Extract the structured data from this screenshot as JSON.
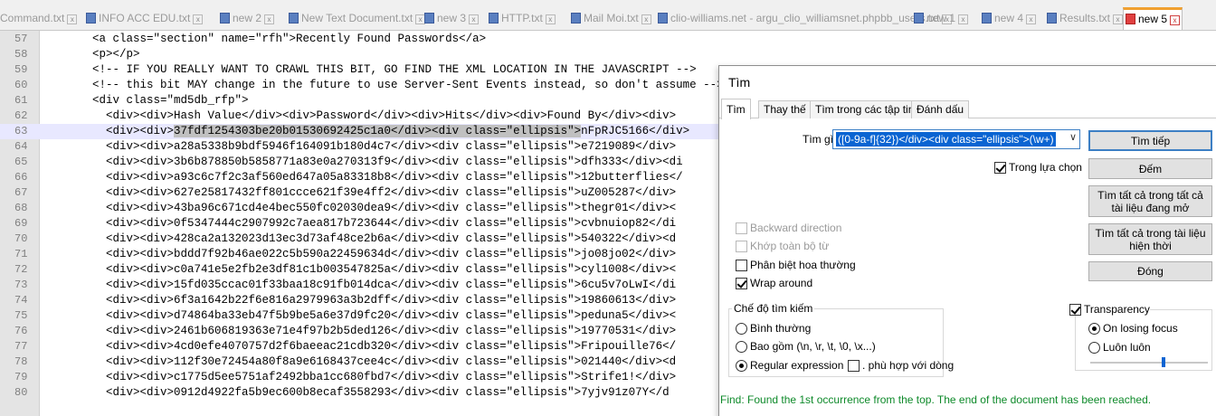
{
  "tabs": [
    {
      "label": "Command.txt",
      "active": false
    },
    {
      "label": "INFO ACC EDU.txt",
      "active": false
    },
    {
      "label": "new 2",
      "active": false
    },
    {
      "label": "New Text Document.txt",
      "active": false
    },
    {
      "label": "new 3",
      "active": false
    },
    {
      "label": "HTTP.txt",
      "active": false
    },
    {
      "label": "Mail Moi.txt",
      "active": false
    },
    {
      "label": "clio-williams.net - argu_clio_williamsnet.phpbb_users.txt",
      "active": false
    },
    {
      "label": "new 1",
      "active": false
    },
    {
      "label": "new 4",
      "active": false
    },
    {
      "label": "Results.txt",
      "active": false
    },
    {
      "label": "new 5",
      "active": true
    }
  ],
  "tab_close_glyph": "x",
  "editor": {
    "lines": [
      {
        "num": "57",
        "text": "<a class=\"section\" name=\"rfh\">Recently Found Passwords</a>"
      },
      {
        "num": "58",
        "text": "<p></p>"
      },
      {
        "num": "59",
        "text": "<!-- IF YOU REALLY WANT TO CRAWL THIS BIT, GO FIND THE XML LOCATION IN THE JAVASCRIPT -->"
      },
      {
        "num": "60",
        "text": "<!-- this bit MAY change in the future to use Server-Sent Events instead, so don't assume -->"
      },
      {
        "num": "61",
        "text": "<div class=\"md5db_rfp\">"
      },
      {
        "num": "62",
        "text": "  <div><div>Hash Value</div><div>Password</div><div>Hits</div><div>Found By</div><div>"
      },
      {
        "num": "63",
        "pre": "  <div><div>",
        "sel": "37fdf1254303be20b01530692425c1a0</div><div class=\"ellipsis\">",
        "post": "nFpRJC5166</div>"
      },
      {
        "num": "64",
        "text": "  <div><div>a28a5338b9bdf5946f164091b180d4c7</div><div class=\"ellipsis\">e7219089</div>"
      },
      {
        "num": "65",
        "text": "  <div><div>3b6b878850b5858771a83e0a270313f9</div><div class=\"ellipsis\">dfh333</div><di"
      },
      {
        "num": "66",
        "text": "  <div><div>a93c6c7f2c3af560ed647a05a83318b8</div><div class=\"ellipsis\">12butterflies</"
      },
      {
        "num": "67",
        "text": "  <div><div>627e25817432ff801ccce621f39e4ff2</div><div class=\"ellipsis\">uZ005287</div>"
      },
      {
        "num": "68",
        "text": "  <div><div>43ba96c671cd4e4bec550fc02030dea9</div><div class=\"ellipsis\">thegr01</div><"
      },
      {
        "num": "69",
        "text": "  <div><div>0f5347444c2907992c7aea817b723644</div><div class=\"ellipsis\">cvbnuiop82</di"
      },
      {
        "num": "70",
        "text": "  <div><div>428ca2a132023d13ec3d73af48ce2b6a</div><div class=\"ellipsis\">540322</div><d"
      },
      {
        "num": "71",
        "text": "  <div><div>bddd7f92b46ae022c5b590a22459634d</div><div class=\"ellipsis\">jo08jo02</div>"
      },
      {
        "num": "72",
        "text": "  <div><div>c0a741e5e2fb2e3df81c1b003547825a</div><div class=\"ellipsis\">cyl1008</div><"
      },
      {
        "num": "73",
        "text": "  <div><div>15fd035ccac01f33baa18c91fb014dca</div><div class=\"ellipsis\">6cu5v7oLwI</di"
      },
      {
        "num": "74",
        "text": "  <div><div>6f3a1642b22f6e816a2979963a3b2dff</div><div class=\"ellipsis\">19860613</div>"
      },
      {
        "num": "75",
        "text": "  <div><div>d74864ba33eb47f5b9be5a6e37d9fc20</div><div class=\"ellipsis\">peduna5</div><"
      },
      {
        "num": "76",
        "text": "  <div><div>2461b606819363e71e4f97b2b5ded126</div><div class=\"ellipsis\">19770531</div>"
      },
      {
        "num": "77",
        "text": "  <div><div>4cd0efe4070757d2f6baeeac21cdb320</div><div class=\"ellipsis\">Fripouille76</"
      },
      {
        "num": "78",
        "text": "  <div><div>112f30e72454a80f8a9e6168437cee4c</div><div class=\"ellipsis\">021440</div><d"
      },
      {
        "num": "79",
        "text": "  <div><div>c1775d5ee5751af2492bba1cc680fbd7</div><div class=\"ellipsis\">Strife1!</div>"
      },
      {
        "num": "80",
        "text": "  <div><div>0912d4922fa5b9ec600b8ecaf3558293</div><div class=\"ellipsis\">7yjv91z07Y</d"
      }
    ]
  },
  "find_dialog": {
    "title": "Tìm",
    "tabs": [
      "Tìm",
      "Thay thế",
      "Tìm trong các tập tin",
      "Đánh dấu"
    ],
    "find_label": "Tìm gì:",
    "find_value": "([0-9a-f]{32})</div><div class=\"ellipsis\">(\\w+)",
    "combo_arrow": "∨",
    "in_selection": {
      "label": "Trong lựa chọn",
      "checked": true
    },
    "buttons": {
      "find_next": "Tìm tiếp",
      "count": "Đếm",
      "find_all_opened": "Tìm tất cả trong tất cả tài liệu đang mở",
      "find_all_current": "Tìm tất cả trong tài liệu hiện thời",
      "close": "Đóng"
    },
    "options": {
      "backward": {
        "label": "Backward direction",
        "checked": false,
        "disabled": true
      },
      "whole_word": {
        "label": "Khớp toàn bộ từ",
        "checked": false,
        "disabled": true
      },
      "match_case": {
        "label": "Phân biệt hoa thường",
        "checked": false,
        "disabled": false
      },
      "wrap_around": {
        "label": "Wrap around",
        "checked": true,
        "disabled": false
      }
    },
    "search_mode": {
      "title": "Chế độ tìm kiếm",
      "normal": "Bình thường",
      "extended": "Bao gồm (\\n, \\r, \\t, \\0, \\x...)",
      "regex": "Regular expression",
      "dot_newline": ". phù hợp với dòng",
      "selected": "regex"
    },
    "transparency": {
      "label": "Transparency",
      "checked": true,
      "on_losing_focus": "On losing focus",
      "always": "Luôn luôn",
      "selected": "on_losing_focus",
      "level": 0.62
    },
    "status": "Find: Found the 1st occurrence from the top. The end of the document has been reached."
  }
}
